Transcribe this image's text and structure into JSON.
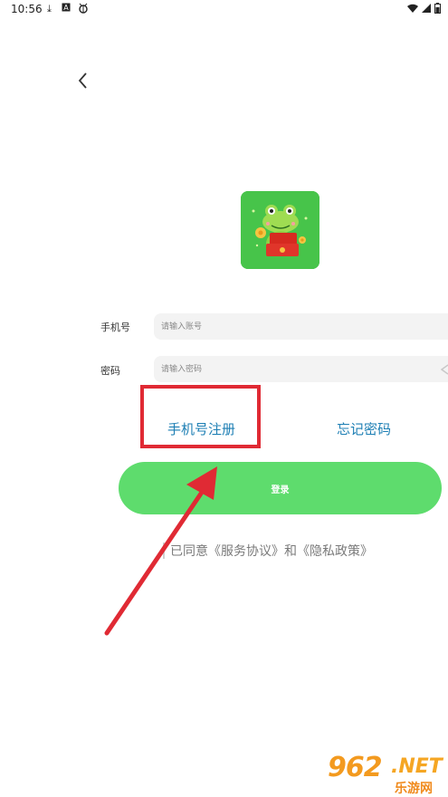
{
  "status_bar": {
    "time": "10:56",
    "icons": [
      "download-icon",
      "a-icon",
      "bug-icon"
    ],
    "right_icons": [
      "wifi-icon",
      "signal-icon",
      "battery-icon"
    ]
  },
  "login": {
    "phone_label": "手机号",
    "phone_placeholder": "请输入账号",
    "password_label": "密码",
    "password_placeholder": "请输入密码",
    "register_link": "手机号注册",
    "forgot_link": "忘记密码",
    "login_button": "登录",
    "agreement_text": "已同意《服务协议》和《隐私政策》"
  },
  "watermark": {
    "number": "962",
    "suffix": ".NET",
    "subtitle": "乐游网"
  },
  "colors": {
    "accent_green": "#5edc6d",
    "logo_green": "#47c44a",
    "link_blue": "#1e7fb4",
    "annotation_red": "#e02a34"
  }
}
